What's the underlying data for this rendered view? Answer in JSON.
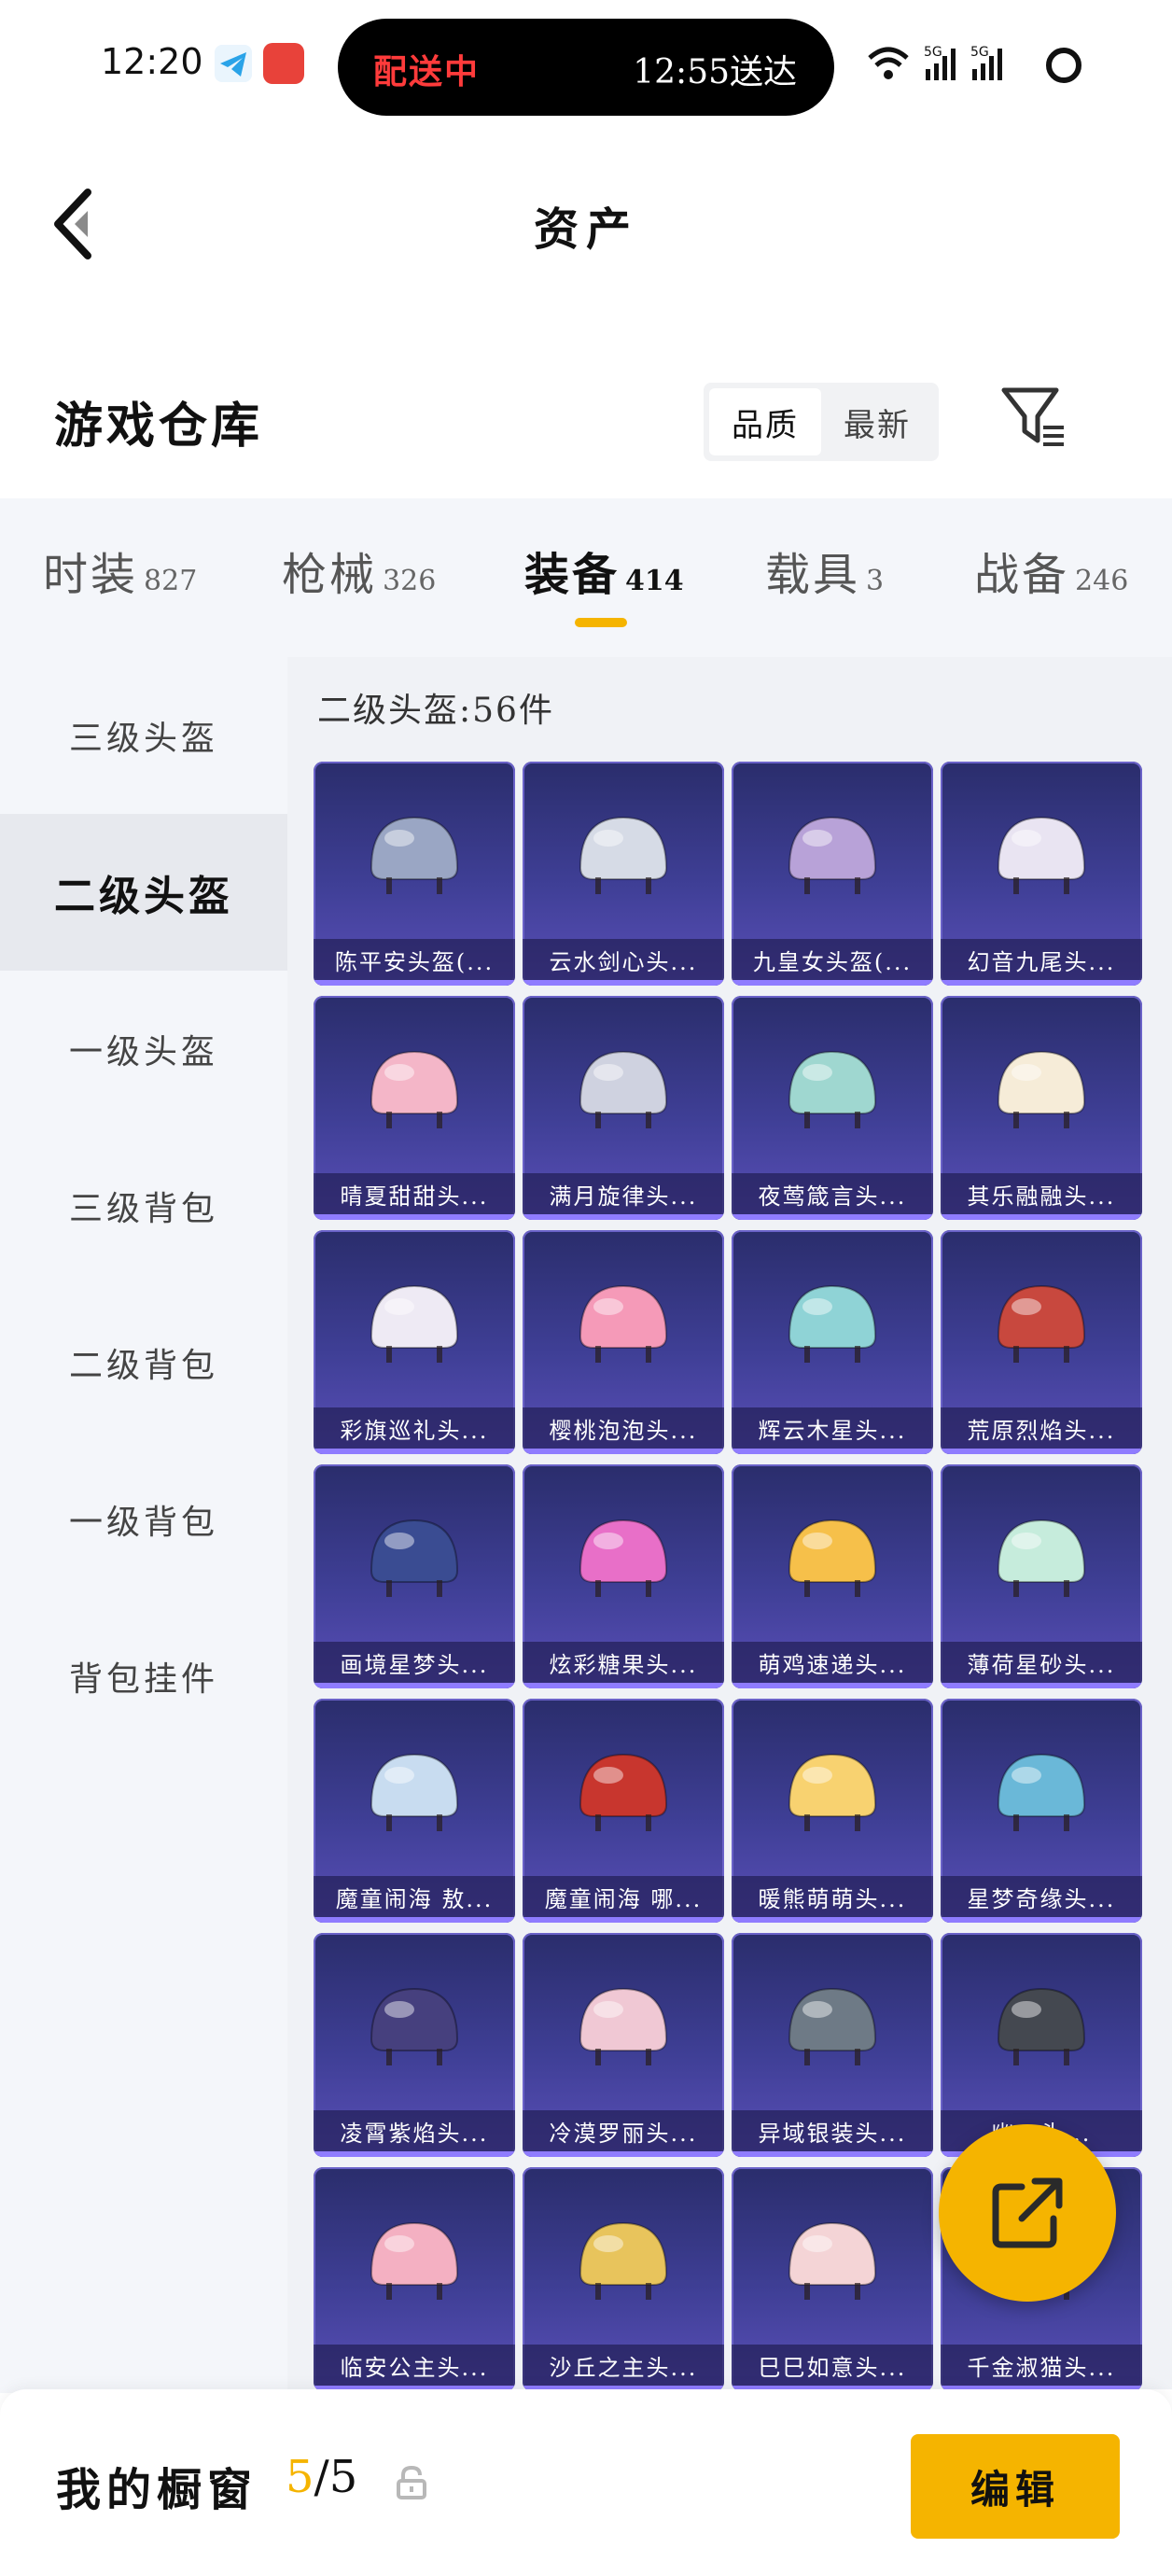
{
  "status_bar": {
    "time": "12:20",
    "delivery_status": "配送中",
    "delivery_eta": "12:55送达",
    "icons": [
      "telegram-icon",
      "app-icon",
      "wifi-icon",
      "signal-5g-icon",
      "signal-5g-icon",
      "battery-ring-icon"
    ]
  },
  "header": {
    "title": "资产",
    "back_icon": "back-arrow-icon"
  },
  "section": {
    "title": "游戏仓库",
    "sort_options": [
      "品质",
      "最新"
    ],
    "sort_active": "品质",
    "filter_icon": "filter-icon"
  },
  "tabs": [
    {
      "label": "时装",
      "count": "827"
    },
    {
      "label": "枪械",
      "count": "326"
    },
    {
      "label": "装备",
      "count": "414",
      "active": true
    },
    {
      "label": "载具",
      "count": "3"
    },
    {
      "label": "战备",
      "count": "246"
    }
  ],
  "sidebar": {
    "items": [
      "三级头盔",
      "二级头盔",
      "一级头盔",
      "三级背包",
      "二级背包",
      "一级背包",
      "背包挂件"
    ],
    "active": "二级头盔"
  },
  "content": {
    "count_label": "二级头盔:56件",
    "items": [
      {
        "name": "陈平安头盔(...",
        "color": "#9aa6c4"
      },
      {
        "name": "云水剑心头...",
        "color": "#d6dbe6"
      },
      {
        "name": "九皇女头盔(...",
        "color": "#b8a2d8"
      },
      {
        "name": "幻音九尾头...",
        "color": "#e9e4f2"
      },
      {
        "name": "晴夏甜甜头...",
        "color": "#f4b6c8"
      },
      {
        "name": "满月旋律头...",
        "color": "#cfd2e0"
      },
      {
        "name": "夜莺箴言头...",
        "color": "#9fd7d0"
      },
      {
        "name": "其乐融融头...",
        "color": "#f6ecd8"
      },
      {
        "name": "彩旗巡礼头...",
        "color": "#eeeaf4"
      },
      {
        "name": "樱桃泡泡头...",
        "color": "#f59ab8"
      },
      {
        "name": "辉云木星头...",
        "color": "#8fd3d6"
      },
      {
        "name": "荒原烈焰头...",
        "color": "#c8483e"
      },
      {
        "name": "画境星梦头...",
        "color": "#3a4c92"
      },
      {
        "name": "炫彩糖果头...",
        "color": "#e86fc8"
      },
      {
        "name": "萌鸡速递头...",
        "color": "#f6c04a"
      },
      {
        "name": "薄荷星砂头...",
        "color": "#c6ecdc"
      },
      {
        "name": "魔童闹海 敖...",
        "color": "#c8dcf0"
      },
      {
        "name": "魔童闹海 哪...",
        "color": "#c8362e"
      },
      {
        "name": "暖熊萌萌头...",
        "color": "#f8d270"
      },
      {
        "name": "星梦奇缘头...",
        "color": "#6ab8d8"
      },
      {
        "name": "凌霄紫焰头...",
        "color": "#46407e"
      },
      {
        "name": "冷漠罗丽头...",
        "color": "#f0c8d4"
      },
      {
        "name": "异域银装头...",
        "color": "#6e7a86"
      },
      {
        "name": "幽…头...",
        "color": "#444850"
      },
      {
        "name": "临安公主头...",
        "color": "#f4b0c2"
      },
      {
        "name": "沙丘之主头...",
        "color": "#e8c45c"
      },
      {
        "name": "巳巳如意头...",
        "color": "#f4d4d6"
      },
      {
        "name": "千金淑猫头...",
        "color": "#e0d8f0"
      }
    ]
  },
  "fab": {
    "icon": "share-export-icon"
  },
  "bottom_bar": {
    "label": "我的橱窗",
    "count_current": "5",
    "count_total": "/5",
    "lock_icon": "lock-icon",
    "edit_label": "编辑"
  },
  "colors": {
    "accent": "#f5b400",
    "card_bg_top": "#2a2d6c",
    "card_bg_bottom": "#5a4fb8",
    "panel_bg": "#f4f6fa"
  }
}
